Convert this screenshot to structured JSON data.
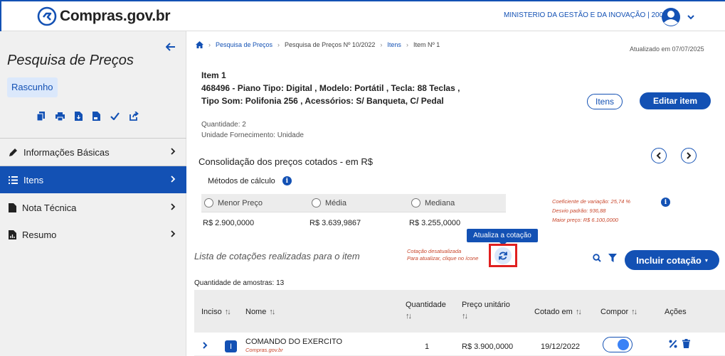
{
  "header": {
    "logo_text": "Compras.gov.br",
    "org": "MINISTERIO DA GESTÃO E DA INOVAÇÃO | 200999"
  },
  "sidebar": {
    "title": "Pesquisa de Preços",
    "status": "Rascunho",
    "items": [
      {
        "label": "Informações Básicas",
        "icon": "pencil-icon"
      },
      {
        "label": "Itens",
        "icon": "list-icon",
        "active": true
      },
      {
        "label": "Nota Técnica",
        "icon": "document-icon"
      },
      {
        "label": "Resumo",
        "icon": "file-chart-icon"
      }
    ]
  },
  "breadcrumb": {
    "items": [
      "Pesquisa de Preços",
      "Pesquisa de Preços Nº 10/2022",
      "Itens"
    ],
    "current": "Item Nº 1"
  },
  "updated": "Atualizado em 07/07/2025",
  "item": {
    "number": "Item 1",
    "description": "468496 - Piano Tipo: Digital , Modelo: Portátil , Tecla: 88 Teclas , Tipo Som: Polifonia 256 , Acessórios: S/ Banqueta, C/ Pedal",
    "quantity": "Quantidade: 2",
    "unit": "Unidade Fornecimento: Unidade",
    "btn_items": "Itens",
    "btn_edit": "Editar item"
  },
  "consolidation": {
    "title": "Consolidação dos preços cotados - em R$",
    "methods_label": "Métodos de cálculo",
    "options": [
      "Menor Preço",
      "Média",
      "Mediana"
    ],
    "values": [
      "R$ 2.900,0000",
      "R$ 3.639,9867",
      "R$ 3.255,0000"
    ],
    "stats": [
      "Coeficiente de variação: 25,74 %",
      "Desvio padrão: 936,88",
      "Maior preço: R$ 6.100,0000"
    ]
  },
  "quotes": {
    "tooltip": "Atualiza a cotação",
    "list_title": "Lista de cotações realizadas para o item",
    "outdated_line1": "Cotação desatualizada",
    "outdated_line2": "Para atualizar, clique no ícone",
    "include_button": "Incluir cotação",
    "samples": "Quantidade de amostras: 13",
    "columns": {
      "inciso": "Inciso",
      "nome": "Nome",
      "quantidade": "Quantidade",
      "preco": "Preço unitário",
      "cotado": "Cotado em",
      "compor": "Compor",
      "acoes": "Ações"
    },
    "rows": [
      {
        "inciso": "I",
        "nome": "COMANDO DO EXERCITO",
        "fonte": "Compras.gov.br",
        "quantidade": "1",
        "preco": "R$ 3.900,0000",
        "cotado": "19/12/2022",
        "compor": true
      }
    ]
  },
  "colors": {
    "primary": "#1351b4",
    "warning_text": "#c8462b",
    "highlight_border": "#e02020"
  }
}
